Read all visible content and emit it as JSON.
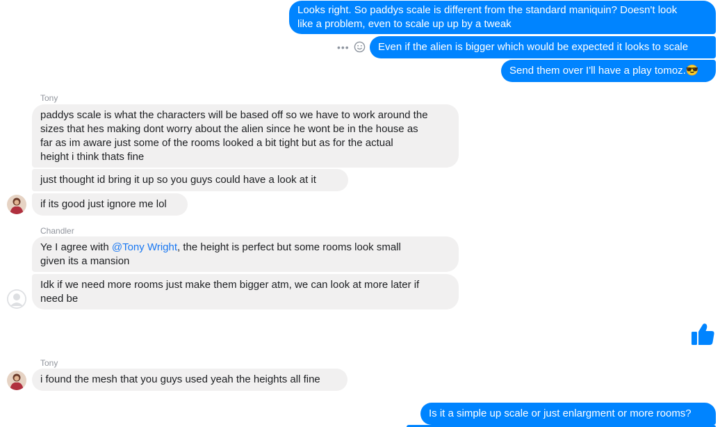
{
  "outgoing": [
    {
      "line1": "Looks right. So paddys scale is different from the standard maniquin? Doesn't look",
      "line2": "like a problem, even to scale up up by a tweak"
    },
    {
      "text": "Even if the alien is bigger which would be expected it looks to scale"
    },
    {
      "text": "Send them over I'll have a play tomoz.",
      "emoji": "😎"
    }
  ],
  "group1": {
    "sender": "Tony",
    "messages": [
      {
        "lines": [
          "paddys scale is what the characters will be based off so we have to work around the",
          "sizes that hes making dont worry about the alien since he wont be in the house as",
          "far as im aware just some of the rooms looked a bit tight but as for the actual",
          "height i think thats fine"
        ]
      },
      {
        "text": "just thought id bring it up so you guys could have a look at it"
      },
      {
        "text": "if its good just ignore me lol"
      }
    ]
  },
  "group2": {
    "sender": "Chandler",
    "msg1": {
      "prefix": "Ye I agree with ",
      "mention": "@Tony Wright",
      "suffix": ", the height is perfect but some rooms look small",
      "line2": "given its a mansion"
    },
    "msg2": {
      "line1": "Idk if we need more rooms just make them bigger atm, we can look at more later if",
      "line2": "need be"
    }
  },
  "group3": {
    "sender": "Tony",
    "text": "i found the mesh that you guys used yeah the heights all fine"
  },
  "outgoing_last": "Is it a simple up scale or just enlargment or more rooms?",
  "icons": {
    "like": "thumbs-up-icon",
    "more": "more-options-icon",
    "react": "emoji-react-icon"
  },
  "colors": {
    "outgoing": "#0084ff",
    "incoming": "#f1f0f0",
    "mention": "#1877f2"
  }
}
